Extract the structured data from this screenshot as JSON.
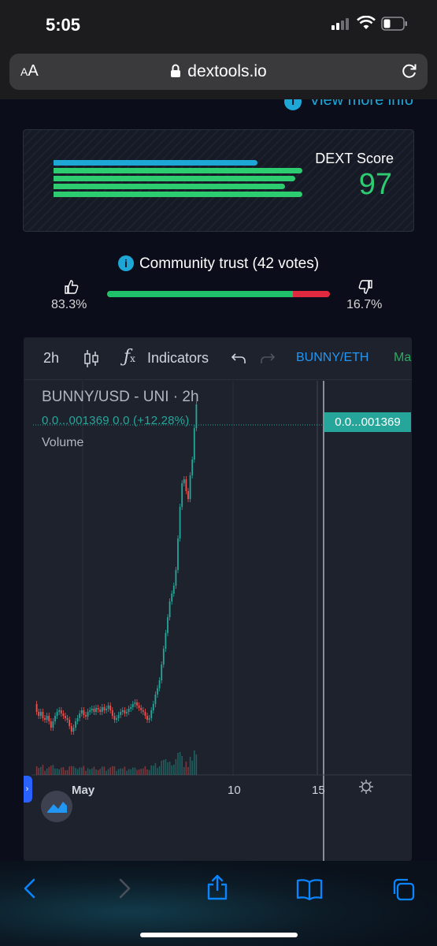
{
  "status_bar": {
    "time": "5:05"
  },
  "browser": {
    "text_size_label_small": "A",
    "text_size_label_large": "A",
    "domain": "dextools.io"
  },
  "page": {
    "view_more_label": "View more info",
    "dext_score": {
      "label": "DEXT Score",
      "value": "97",
      "bars": [
        0.82,
        1.0,
        0.97,
        0.93,
        1.0
      ],
      "colors": [
        "#1ea7d6",
        "#2ecc71"
      ]
    },
    "community_trust": {
      "title": "Community trust (42 votes)",
      "up_pct": "83.3%",
      "down_pct": "16.7%",
      "up_fraction": 0.833
    }
  },
  "chart": {
    "toolbar": {
      "interval": "2h",
      "indicators_label": "Indicators",
      "pair": "BUNNY/ETH",
      "ma_label": "Ma"
    },
    "legend": {
      "title": "BUNNY/USD - UNI · 2h",
      "values": "0.0...001369 0.0 (+12.28%)",
      "volume": "Volume"
    },
    "price_tag": "0.0...001369",
    "x_labels": [
      "May",
      "10",
      "15"
    ],
    "colors": {
      "up": "#26a69a",
      "down": "#ef5350"
    }
  }
}
